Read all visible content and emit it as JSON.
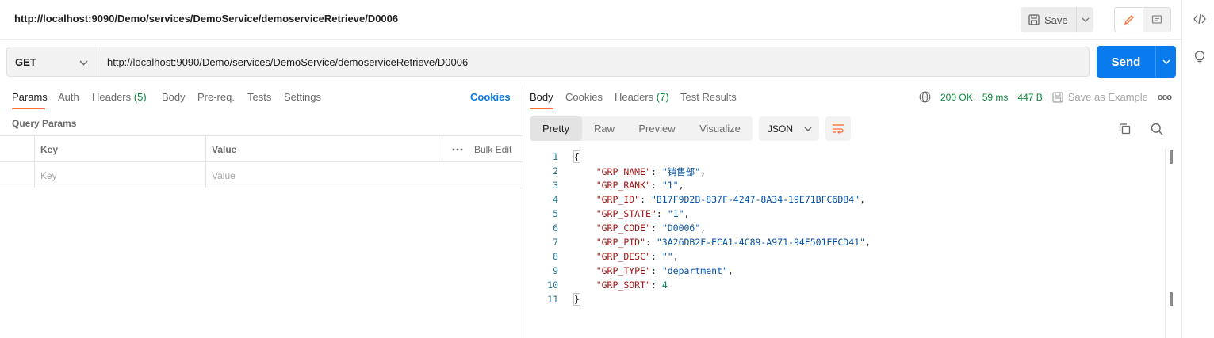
{
  "header": {
    "title": "http://localhost:9090/Demo/services/DemoService/demoserviceRetrieve/D0006",
    "save_label": "Save"
  },
  "request": {
    "method": "GET",
    "url": "http://localhost:9090/Demo/services/DemoService/demoserviceRetrieve/D0006",
    "send_label": "Send"
  },
  "request_tabs": {
    "params": "Params",
    "auth": "Auth",
    "headers": "Headers",
    "headers_count": "(5)",
    "body": "Body",
    "prereq": "Pre-req.",
    "tests": "Tests",
    "settings": "Settings",
    "cookies": "Cookies"
  },
  "query_params": {
    "label": "Query Params",
    "col_key": "Key",
    "col_value": "Value",
    "bulk_edit": "Bulk Edit",
    "key_placeholder": "Key",
    "value_placeholder": "Value"
  },
  "response_tabs": {
    "body": "Body",
    "cookies": "Cookies",
    "headers": "Headers",
    "headers_count": "(7)",
    "test_results": "Test Results"
  },
  "response_status": {
    "status": "200 OK",
    "time": "59 ms",
    "size": "447 B",
    "save_example": "Save as Example",
    "more": "ooo"
  },
  "format_tabs": {
    "pretty": "Pretty",
    "raw": "Raw",
    "preview": "Preview",
    "visualize": "Visualize",
    "language": "JSON"
  },
  "response_body": {
    "open_brace": "{",
    "close_brace": "}",
    "line_numbers": [
      "1",
      "2",
      "3",
      "4",
      "5",
      "6",
      "7",
      "8",
      "9",
      "10",
      "11"
    ],
    "fields": [
      {
        "key": "\"GRP_NAME\"",
        "value": "\"销售部\"",
        "type": "string"
      },
      {
        "key": "\"GRP_RANK\"",
        "value": "\"1\"",
        "type": "string"
      },
      {
        "key": "\"GRP_ID\"",
        "value": "\"B17F9D2B-837F-4247-8A34-19E71BFC6DB4\"",
        "type": "string"
      },
      {
        "key": "\"GRP_STATE\"",
        "value": "\"1\"",
        "type": "string"
      },
      {
        "key": "\"GRP_CODE\"",
        "value": "\"D0006\"",
        "type": "string"
      },
      {
        "key": "\"GRP_PID\"",
        "value": "\"3A26DB2F-ECA1-4C89-A971-94F501EFCD41\"",
        "type": "string"
      },
      {
        "key": "\"GRP_DESC\"",
        "value": "\"\"",
        "type": "string"
      },
      {
        "key": "\"GRP_TYPE\"",
        "value": "\"department\"",
        "type": "string"
      },
      {
        "key": "\"GRP_SORT\"",
        "value": "4",
        "type": "number"
      }
    ]
  },
  "colors": {
    "accent": "#ff6c37",
    "primary": "#097bed",
    "success": "#0b8a3a"
  },
  "icons": [
    "save-icon",
    "chevron-down-icon",
    "pencil-icon",
    "comment-icon",
    "code-icon",
    "lightbulb-icon",
    "globe-icon",
    "copy-icon",
    "search-icon",
    "wrap-lines-icon"
  ]
}
